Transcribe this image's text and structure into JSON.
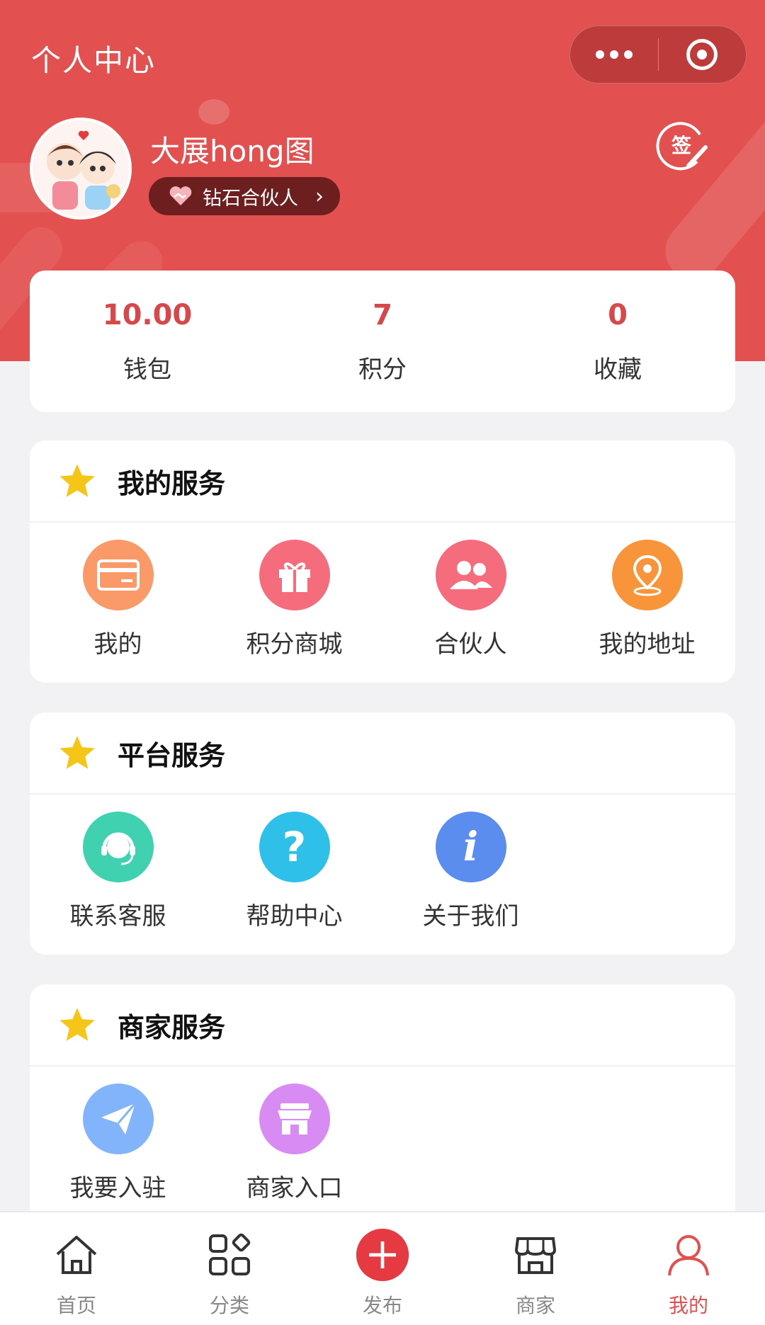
{
  "header": {
    "title": "个人中心",
    "username": "大展hong图",
    "badge_label": "钻石合伙人",
    "sign_label": "签"
  },
  "stats": [
    {
      "value": "10.00",
      "label": "钱包"
    },
    {
      "value": "7",
      "label": "积分"
    },
    {
      "value": "0",
      "label": "收藏"
    }
  ],
  "sections": {
    "my": {
      "title": "我的服务",
      "items": [
        {
          "label": "我的",
          "icon": "card-icon",
          "color": "#fb9a69"
        },
        {
          "label": "积分商城",
          "icon": "gift-icon",
          "color": "#f56d7d"
        },
        {
          "label": "合伙人",
          "icon": "users-icon",
          "color": "#f56d7d"
        },
        {
          "label": "我的地址",
          "icon": "location-icon",
          "color": "#f8953b"
        }
      ]
    },
    "platform": {
      "title": "平台服务",
      "items": [
        {
          "label": "联系客服",
          "icon": "headset-icon",
          "color": "#3fd1b0"
        },
        {
          "label": "帮助中心",
          "icon": "help-icon",
          "color": "#2fc0ea",
          "glyph": "?"
        },
        {
          "label": "关于我们",
          "icon": "info-icon",
          "color": "#5b8def",
          "glyph": "i"
        }
      ]
    },
    "merchant": {
      "title": "商家服务",
      "items": [
        {
          "label": "我要入驻",
          "icon": "paper-plane-icon",
          "color": "#82b4fb"
        },
        {
          "label": "商家入口",
          "icon": "store-icon",
          "color": "#d88bf3"
        }
      ]
    }
  },
  "tabbar": [
    {
      "label": "首页",
      "icon": "home-icon"
    },
    {
      "label": "分类",
      "icon": "category-icon"
    },
    {
      "label": "发布",
      "icon": "plus-icon"
    },
    {
      "label": "商家",
      "icon": "shop-icon"
    },
    {
      "label": "我的",
      "icon": "user-icon",
      "active": true
    }
  ],
  "colors": {
    "brand": "#e2504f",
    "accent_text": "#d8474a",
    "star": "#f5c518"
  }
}
